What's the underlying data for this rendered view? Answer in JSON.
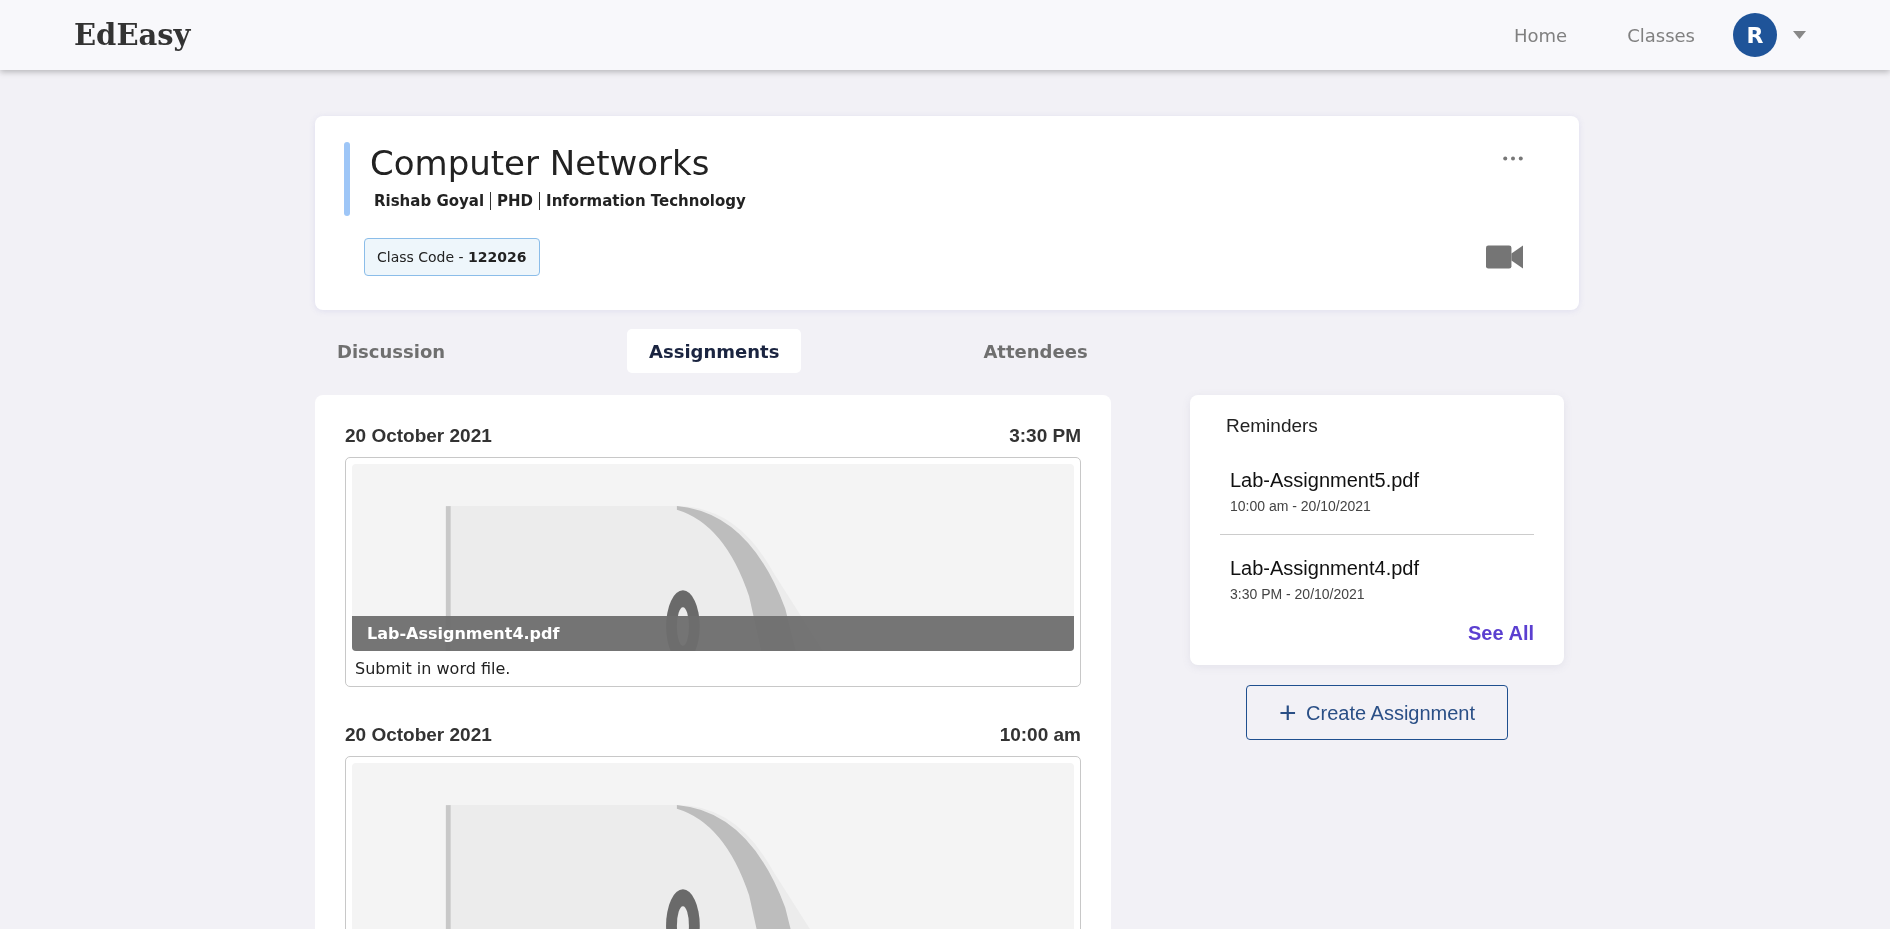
{
  "navbar": {
    "logo": "EdEasy",
    "links": [
      {
        "label": "Home",
        "selected": false
      },
      {
        "label": "Classes",
        "selected": false
      }
    ],
    "avatar": "R"
  },
  "class_card": {
    "title": "Computer Networks",
    "details": [
      "Rishab Goyal",
      "PHD",
      "Information Technology"
    ],
    "code_label": "Class Code - ",
    "code": "122026"
  },
  "tabs": [
    {
      "label": "Discussion",
      "selected": false
    },
    {
      "label": "Assignments",
      "selected": true
    },
    {
      "label": "Attendees",
      "selected": false
    }
  ],
  "assignments": [
    {
      "date": "20 October 2021",
      "time": "3:30 PM",
      "file": "Lab-Assignment4.pdf",
      "note": "Submit in word file.",
      "kind": "picture"
    },
    {
      "date": "20 October 2021",
      "time": "10:00 am",
      "kind": "picture"
    }
  ],
  "reminders": {
    "title": "Reminders",
    "items": [
      {
        "file": "Lab-Assignment5.pdf",
        "when": "10:00 am - 20/10/2021"
      },
      {
        "file": "Lab-Assignment4.pdf",
        "when": "3:30 PM - 20/10/2021"
      }
    ],
    "see_all": "See All"
  },
  "create_button": {
    "icon": "+",
    "label": "Create Assignment"
  }
}
